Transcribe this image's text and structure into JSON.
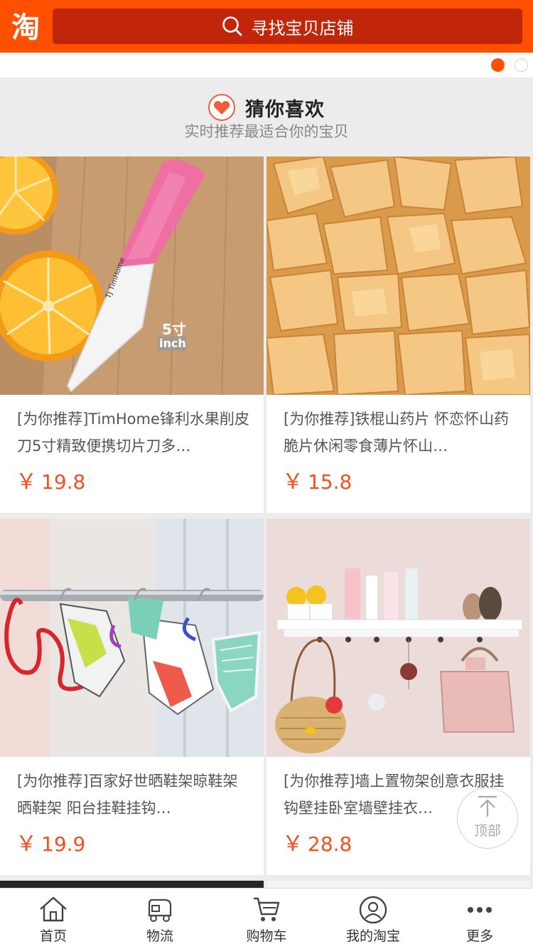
{
  "header": {
    "logo_char": "淘",
    "search_placeholder": "寻找宝贝店铺",
    "search_icon": "search-icon"
  },
  "carousel": {
    "dot_count": 2,
    "active_index": 0,
    "accent": "#ff5000"
  },
  "section": {
    "icon": "heart-icon",
    "title": "猜你喜欢",
    "subtitle": "实时推荐最适合你的宝贝"
  },
  "products": [
    {
      "title": "[为你推荐]TimHome锋利水果削皮刀5寸精致便携切片刀多…",
      "yen": "￥",
      "price": "19.8",
      "image": "ceramic-knife-photo",
      "badge_num": "5寸",
      "badge_unit": "inch"
    },
    {
      "title": "[为你推荐]铁棍山药片 怀恋怀山药脆片休闲零食薄片怀山…",
      "yen": "￥",
      "price": "15.8",
      "image": "yam-chips-photo"
    },
    {
      "title": "[为你推荐]百家好世晒鞋架晾鞋架晒鞋架 阳台挂鞋挂钩…",
      "yen": "￥",
      "price": "19.9",
      "image": "shoe-rack-photo"
    },
    {
      "title": "[为你推荐]墙上置物架创意衣服挂钩壁挂卧室墙壁挂衣…",
      "yen": "￥",
      "price": "28.8",
      "image": "wall-shelf-photo"
    }
  ],
  "back_to_top": {
    "label": "顶部",
    "icon": "arrow-up-icon"
  },
  "bottom_nav": [
    {
      "label": "首页",
      "icon": "home-icon"
    },
    {
      "label": "物流",
      "icon": "truck-icon"
    },
    {
      "label": "购物车",
      "icon": "cart-icon"
    },
    {
      "label": "我的淘宝",
      "icon": "user-icon"
    },
    {
      "label": "更多",
      "icon": "more-icon"
    }
  ],
  "colors": {
    "brand": "#ff5000",
    "search_bg": "#c2260a",
    "price": "#f2501f",
    "page_bg": "#ececec"
  }
}
